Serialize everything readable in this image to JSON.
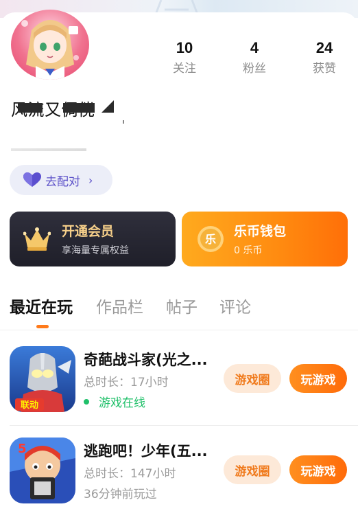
{
  "profile": {
    "username": "风流又倜傥"
  },
  "stats": [
    {
      "value": "10",
      "label": "关注"
    },
    {
      "value": "4",
      "label": "粉丝"
    },
    {
      "value": "24",
      "label": "获赞"
    }
  ],
  "match": {
    "label": "去配对",
    "chevron": "›",
    "icon": "heart-icon"
  },
  "vip": {
    "title": "开通会员",
    "subtitle": "享海量专属权益",
    "icon": "crown-icon"
  },
  "wallet": {
    "title": "乐币钱包",
    "subtitle": "0 乐币",
    "coin_glyph": "乐",
    "icon": "coin-icon"
  },
  "tabs": [
    "最近在玩",
    "作品栏",
    "帖子",
    "评论"
  ],
  "games": [
    {
      "name": "奇葩战斗家(光之...",
      "playtime": "总时长：17小时",
      "status": "游戏在线",
      "badge": "联动",
      "circle_label": "游戏圈",
      "play_label": "玩游戏"
    },
    {
      "name": "逃跑吧！少年(五...",
      "playtime": "总时长：147小时",
      "status": "36分钟前玩过",
      "badge": "5",
      "circle_label": "游戏圈",
      "play_label": "玩游戏"
    }
  ],
  "colors": {
    "accent_orange": "#ff7a1a",
    "online_green": "#20c06a",
    "match_purple": "#5a4fc8",
    "vip_gold": "#f7d08a"
  }
}
